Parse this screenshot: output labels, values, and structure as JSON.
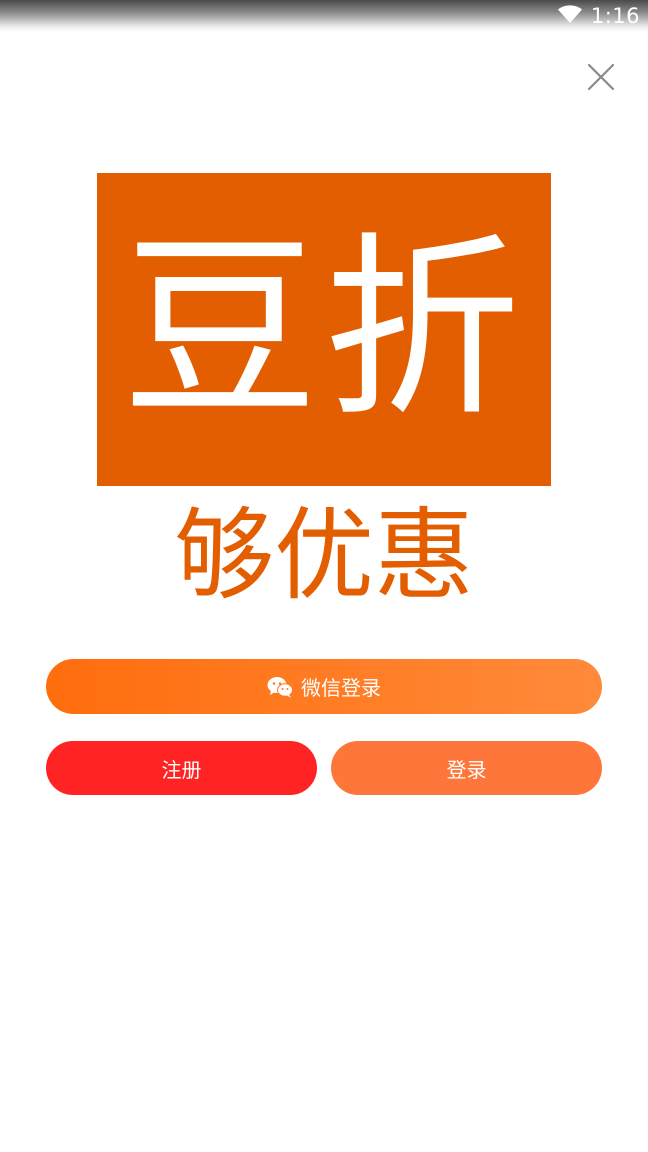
{
  "status_bar": {
    "time": "1:16",
    "wifi_icon": "wifi-icon"
  },
  "close_icon": "close-icon",
  "logo": {
    "text": "豆折",
    "color": "#e35e00"
  },
  "slogan": "够优惠",
  "buttons": {
    "wechat_login": {
      "label": "微信登录",
      "icon": "wechat-icon"
    },
    "register": "注册",
    "login": "登录"
  },
  "colors": {
    "brand": "#e35e00",
    "register_bg": "#ff2323",
    "login_bg": "#ff763a",
    "wechat_gradient_start": "#ff6d0d",
    "wechat_gradient_end": "#ff8a3a"
  }
}
